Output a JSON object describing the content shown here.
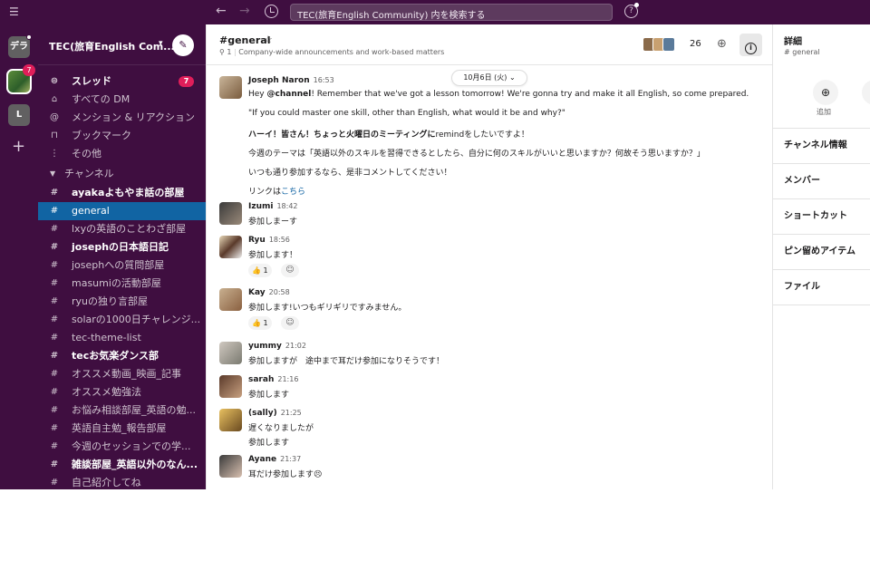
{
  "topbar": {
    "search_text": "TEC(旅育English Community) 内を検索する"
  },
  "workspaces": [
    {
      "label": "デラ"
    },
    {
      "badge": "7"
    },
    {
      "label": "L"
    }
  ],
  "sidebar": {
    "workspace_name": "TEC(旅育English Com...",
    "nav": [
      {
        "icon": "thread-icon",
        "label": "スレッド",
        "badge": "7"
      },
      {
        "icon": "dm-icon",
        "label": "すべての DM"
      },
      {
        "icon": "mention-icon",
        "label": "メンション & リアクション"
      },
      {
        "icon": "bookmark-icon",
        "label": "ブックマーク"
      },
      {
        "icon": "more-icon",
        "label": "その他"
      }
    ],
    "channels_header": "チャンネル",
    "channels": [
      {
        "label": "ayakaよもやま話の部屋",
        "bold": true
      },
      {
        "label": "general",
        "active": true
      },
      {
        "label": "lxyの英語のことわざ部屋"
      },
      {
        "label": "josephの日本語日記",
        "bold": true
      },
      {
        "label": "josephへの質問部屋"
      },
      {
        "label": "masumiの活動部屋"
      },
      {
        "label": "ryuの独り言部屋"
      },
      {
        "label": "solarの1000日チャレンジ..."
      },
      {
        "label": "tec-theme-list"
      },
      {
        "label": "tecお気楽ダンス部",
        "bold": true
      },
      {
        "label": "オススメ動画_映画_記事"
      },
      {
        "label": "オススメ勉強法"
      },
      {
        "label": "お悩み相談部屋_英語の勉..."
      },
      {
        "label": "英語自主勉_報告部屋"
      },
      {
        "label": "今週のセッションでの学..."
      },
      {
        "label": "雑談部屋_英語以外のなん...",
        "bold": true
      },
      {
        "label": "自己紹介してね"
      }
    ]
  },
  "channel": {
    "name": "#general",
    "pins": "1",
    "topic": "Company-wide announcements and work-based matters",
    "member_count": "26"
  },
  "date_divider": "10月6日 (火)",
  "messages": [
    {
      "name": "Joseph Naron",
      "time": "16:53",
      "lines": [
        {
          "pre": "Hey ",
          "mention": "@channel",
          "post": "! Remember that we've got a lesson tomorrow! We're gonna try and make it all English, so come prepared."
        },
        {
          "text": "\"If you could master one skill, other than English, what would it be and why?\""
        },
        {
          "bold": "ハーイ！皆さん！ちょっと火曜日のミーティングに",
          "normal": "remindをしたいですよ！"
        },
        {
          "text": "今週のテーマは「英語以外のスキルを習得できるとしたら、自分に何のスキルがいいと思いますか？何故そう思いますか？」"
        },
        {
          "text": "いつも通り参加するなら、是非コメントしてください！"
        },
        {
          "pre": "リンクは",
          "link": "こちら"
        }
      ]
    },
    {
      "name": "Izumi",
      "time": "18:42",
      "lines": [
        {
          "text": "参加しまーす"
        }
      ]
    },
    {
      "name": "Ryu",
      "time": "18:56",
      "lines": [
        {
          "text": "参加します！"
        }
      ],
      "reaction": {
        "emoji": "👍",
        "count": "1"
      }
    },
    {
      "name": "Kay",
      "time": "20:58",
      "lines": [
        {
          "text": "参加します!いつもギリギリですみません。"
        }
      ],
      "reaction": {
        "emoji": "👍",
        "count": "1"
      }
    },
    {
      "name": "yummy",
      "time": "21:02",
      "lines": [
        {
          "text": "参加しますが　途中まで耳だけ参加になりそうです！"
        }
      ]
    },
    {
      "name": "sarah",
      "time": "21:16",
      "lines": [
        {
          "text": "参加します"
        }
      ]
    },
    {
      "name": "(sally)",
      "time": "21:25",
      "lines": [
        {
          "text": "遅くなりましたが"
        },
        {
          "text": "参加します"
        }
      ]
    },
    {
      "name": "Ayane",
      "time": "21:37",
      "lines": [
        {
          "text": "耳だけ参加します😣"
        }
      ]
    }
  ],
  "details": {
    "title": "詳細",
    "subtitle": "# general",
    "add_label": "追加",
    "sections": [
      "チャンネル情報",
      "メンバー",
      "ショートカット",
      "ピン留めアイテム",
      "ファイル"
    ]
  }
}
